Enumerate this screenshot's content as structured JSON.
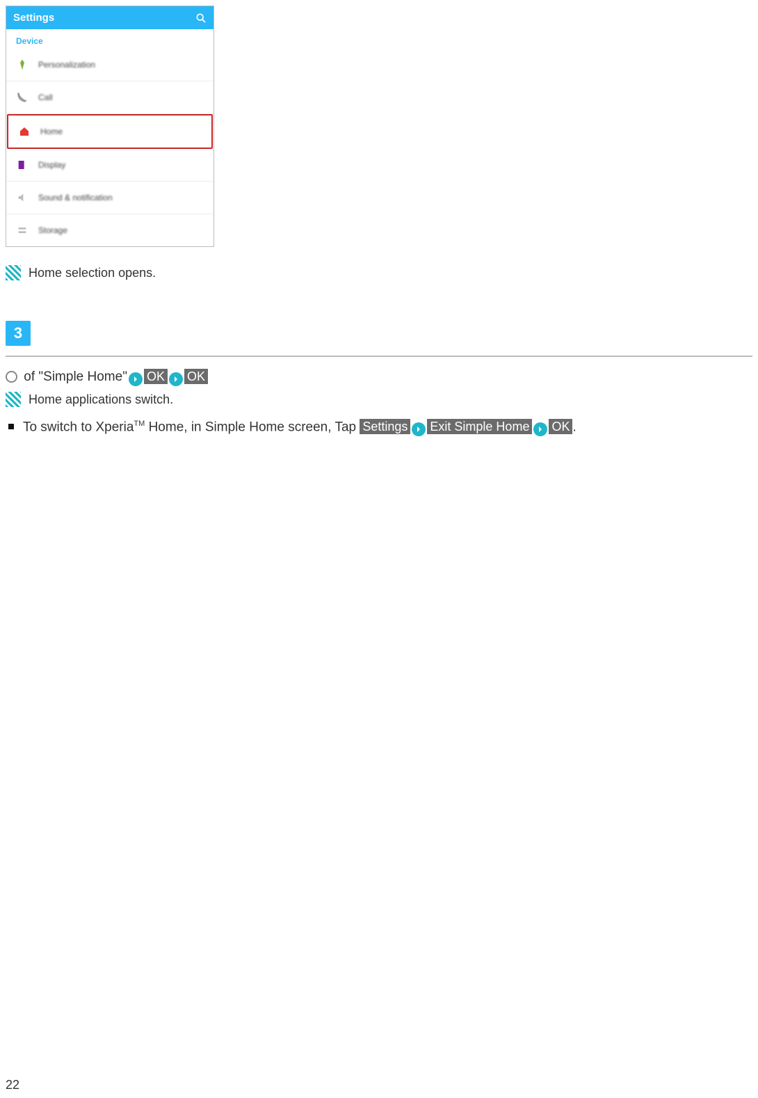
{
  "screenshot": {
    "header_title": "Settings",
    "section_label": "Device",
    "items": [
      {
        "label": "Personalization"
      },
      {
        "label": "Call"
      },
      {
        "label": "Home"
      },
      {
        "label": "Display"
      },
      {
        "label": "Sound & notification"
      },
      {
        "label": "Storage"
      }
    ]
  },
  "result1": "Home selection opens.",
  "step_number": "3",
  "step3_prefix": " of \"Simple Home\"",
  "chip_ok": "OK",
  "result2": "Home applications switch.",
  "note": {
    "prefix": "To switch to Xperia",
    "tm": "TM",
    "mid": " Home, in Simple Home screen, Tap ",
    "btn1": "Settings",
    "btn2": "Exit Simple Home",
    "btn3": "OK",
    "suffix": "."
  },
  "page_number": "22"
}
